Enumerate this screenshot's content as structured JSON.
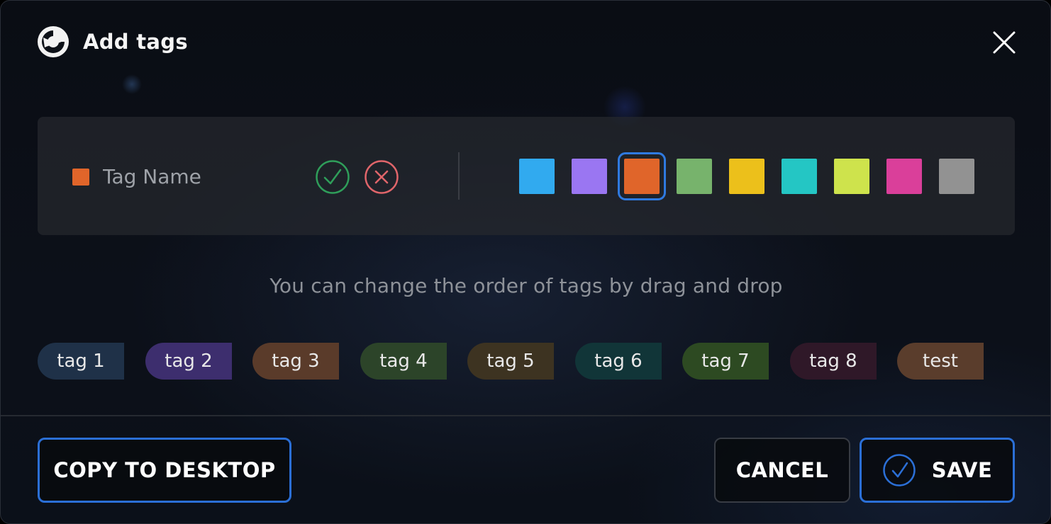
{
  "dialog": {
    "title": "Add tags",
    "logo_icon": "app-logo-icon",
    "close_icon": "close-icon"
  },
  "editor": {
    "current_color": "#e0652a",
    "tag_name_placeholder": "Tag Name",
    "tag_name_value": "",
    "confirm_icon": "check-circle-icon",
    "confirm_color": "#2f9e5a",
    "cancel_icon": "x-circle-icon",
    "cancel_color": "#e0656a",
    "palette": [
      {
        "color": "#31aaef",
        "selected": false
      },
      {
        "color": "#9a76f2",
        "selected": false
      },
      {
        "color": "#e0652a",
        "selected": true
      },
      {
        "color": "#77b36c",
        "selected": false
      },
      {
        "color": "#ecc01b",
        "selected": false
      },
      {
        "color": "#24c6c4",
        "selected": false
      },
      {
        "color": "#cee34c",
        "selected": false
      },
      {
        "color": "#da3f9a",
        "selected": false
      },
      {
        "color": "#929292",
        "selected": false
      }
    ],
    "selection_color": "#2f7ae0"
  },
  "hint": "You can change the order of tags by drag and drop",
  "tags": [
    {
      "label": "tag 1",
      "bg": "#1f3148"
    },
    {
      "label": "tag 2",
      "bg": "#3d2e6e"
    },
    {
      "label": "tag 3",
      "bg": "#5a3b2a"
    },
    {
      "label": "tag 4",
      "bg": "#2c4429"
    },
    {
      "label": "tag 5",
      "bg": "#3d3321"
    },
    {
      "label": "tag 6",
      "bg": "#113538"
    },
    {
      "label": "tag 7",
      "bg": "#2d4a22"
    },
    {
      "label": "tag 8",
      "bg": "#2f1828"
    },
    {
      "label": "test",
      "bg": "#5a3d2c"
    }
  ],
  "footer": {
    "copy_label": "COPY TO DESKTOP",
    "cancel_label": "CANCEL",
    "save_label": "SAVE",
    "save_icon": "check-circle-icon",
    "accent": "#2b6fd6"
  }
}
